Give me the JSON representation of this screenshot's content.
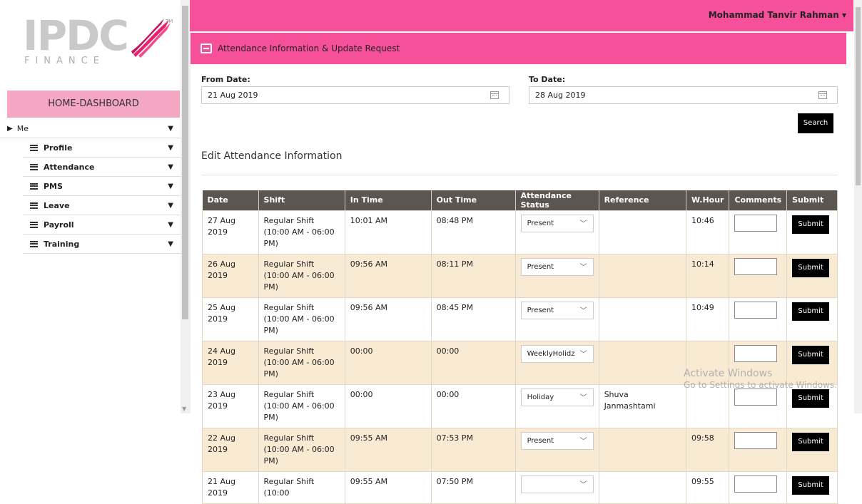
{
  "brand": {
    "logo_text": "IPDC",
    "logo_sub": "FINANCE",
    "tm": "TM"
  },
  "sidebar": {
    "home": "HOME-DASHBOARD",
    "me": "Me",
    "items": [
      {
        "label": "Profile"
      },
      {
        "label": "Attendance"
      },
      {
        "label": "PMS"
      },
      {
        "label": "Leave"
      },
      {
        "label": "Payroll"
      },
      {
        "label": "Training"
      }
    ]
  },
  "header": {
    "user": "Mohammad Tanvir Rahman"
  },
  "panel": {
    "title": "Attendance Information & Update Request",
    "from_label": "From Date:",
    "from_value": "21 Aug 2019",
    "to_label": "To Date:",
    "to_value": "28 Aug 2019",
    "search_label": "Search",
    "section_title": "Edit Attendance Information"
  },
  "table": {
    "headers": [
      "Date",
      "Shift",
      "In Time",
      "Out Time",
      "Attendance Status",
      "Reference",
      "W.Hour",
      "Comments",
      "Submit"
    ],
    "submit_label": "Submit",
    "rows": [
      {
        "date": "27 Aug 2019",
        "shift": "Regular Shift (10:00 AM - 06:00 PM)",
        "in": "10:01 AM",
        "out": "08:48 PM",
        "status": "Present",
        "ref": "",
        "whour": "10:46"
      },
      {
        "date": "26 Aug 2019",
        "shift": "Regular Shift (10:00 AM - 06:00 PM)",
        "in": "09:56 AM",
        "out": "08:11 PM",
        "status": "Present",
        "ref": "",
        "whour": "10:14"
      },
      {
        "date": "25 Aug 2019",
        "shift": "Regular Shift (10:00 AM - 06:00 PM)",
        "in": "09:56 AM",
        "out": "08:45 PM",
        "status": "Present",
        "ref": "",
        "whour": "10:49"
      },
      {
        "date": "24 Aug 2019",
        "shift": "Regular Shift (10:00 AM - 06:00 PM)",
        "in": "00:00",
        "out": "00:00",
        "status": "WeeklyHolidz",
        "ref": "",
        "whour": ""
      },
      {
        "date": "23 Aug 2019",
        "shift": "Regular Shift (10:00 AM - 06:00 PM)",
        "in": "00:00",
        "out": "00:00",
        "status": "Holiday",
        "ref": "Shuva Janmashtami",
        "whour": ""
      },
      {
        "date": "22 Aug 2019",
        "shift": "Regular Shift (10:00 AM - 06:00 PM)",
        "in": "09:55 AM",
        "out": "07:53 PM",
        "status": "Present",
        "ref": "",
        "whour": "09:58"
      },
      {
        "date": "21 Aug 2019",
        "shift": "Regular Shift (10:00",
        "in": "09:55 AM",
        "out": "07:50 PM",
        "status": "",
        "ref": "",
        "whour": "09:55"
      }
    ]
  },
  "watermark": {
    "line1": "Activate Windows",
    "line2": "Go to Settings to activate Windows."
  },
  "colors": {
    "accent": "#f7509a",
    "home_bg": "#f5a6c3",
    "table_head": "#5c5653",
    "row_alt": "#f9ebd3"
  }
}
